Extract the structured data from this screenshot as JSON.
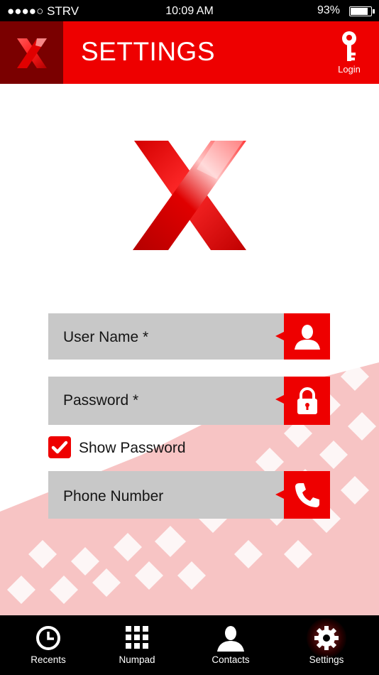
{
  "status_bar": {
    "carrier": "●●●●○ STRV",
    "time": "10:09 AM",
    "battery_percent": "93%",
    "battery_level": 0.93
  },
  "header": {
    "title": "SETTINGS",
    "login_label": "Login",
    "icons": {
      "logo": "x-logo-icon",
      "login": "key-icon"
    }
  },
  "form": {
    "username": {
      "label": "User Name *",
      "icon": "user-icon"
    },
    "password": {
      "label": "Password *",
      "icon": "lock-icon"
    },
    "show_password": {
      "label": "Show Password",
      "checked": true
    },
    "phone": {
      "label": "Phone Number",
      "icon": "phone-icon"
    }
  },
  "tabs": [
    {
      "label": "Recents",
      "icon": "clock-icon",
      "active": false
    },
    {
      "label": "Numpad",
      "icon": "grid-icon",
      "active": false
    },
    {
      "label": "Contacts",
      "icon": "person-icon",
      "active": false
    },
    {
      "label": "Settings",
      "icon": "gear-icon",
      "active": true
    }
  ],
  "colors": {
    "brand_red": "#ee0000",
    "dark_red": "#7a0000",
    "field_gray": "#c8c8c8",
    "bar_black": "#000000"
  }
}
